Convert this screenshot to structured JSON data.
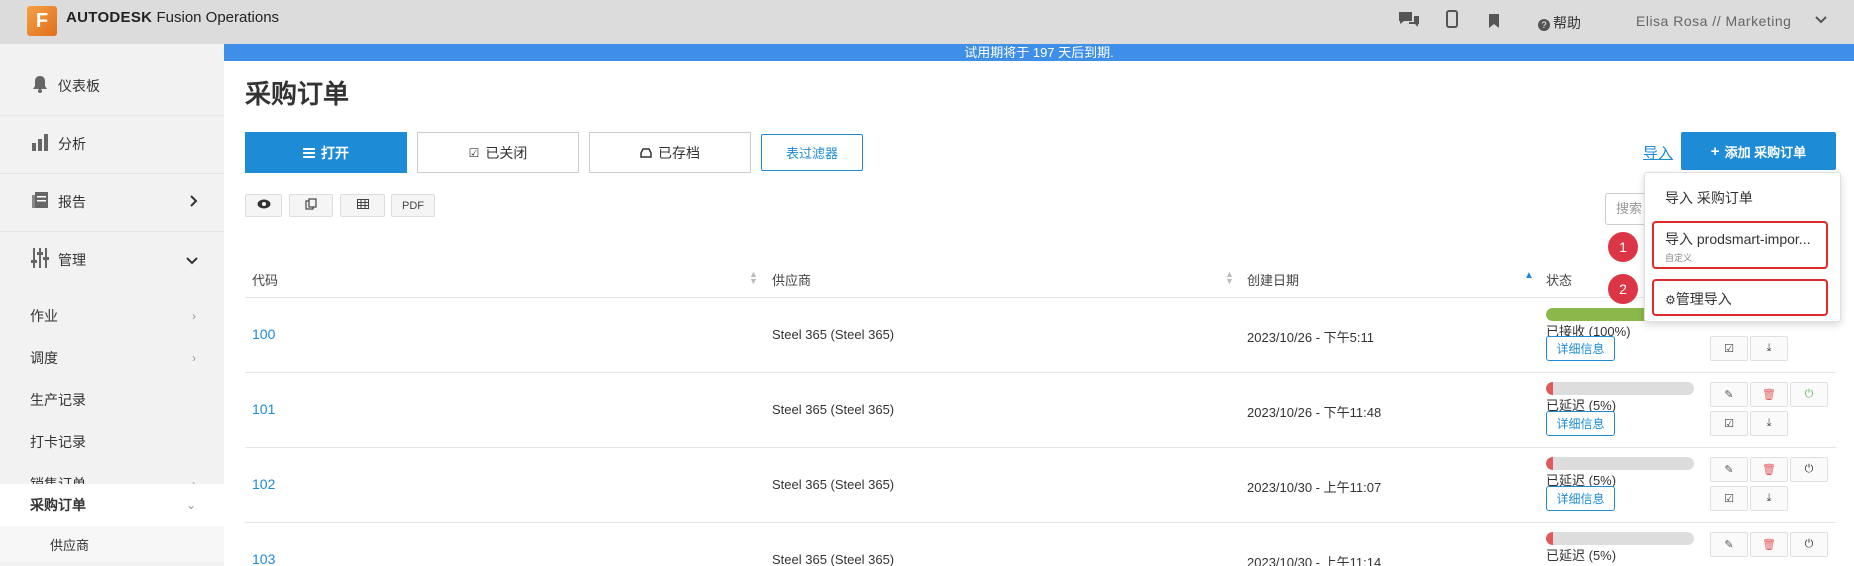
{
  "app": {
    "logo_letter": "F",
    "brand_bold": "AUTODESK",
    "brand_rest": "Fusion Operations",
    "help_label": "帮助",
    "user_label": "Elisa Rosa // Marketing",
    "trial_text": "试用期将于 197 天后到期."
  },
  "sidebar": {
    "main": [
      {
        "label": "仪表板",
        "icon": "bell-icon"
      },
      {
        "label": "分析",
        "icon": "bar-chart-icon"
      },
      {
        "label": "报告",
        "icon": "report-icon"
      },
      {
        "label": "管理",
        "icon": "sliders-icon"
      }
    ],
    "sub": [
      {
        "label": "作业"
      },
      {
        "label": "调度"
      },
      {
        "label": "生产记录"
      },
      {
        "label": "打卡记录"
      },
      {
        "label": "销售订单"
      },
      {
        "label": "采购订单"
      },
      {
        "label": "供应商"
      }
    ]
  },
  "page": {
    "title": "采购订单",
    "tabs": [
      "打开",
      "已关闭",
      "已存档"
    ],
    "filter_label": "表过滤器",
    "import_label": "导入",
    "add_label": "添加 采购订单",
    "tools": [
      "PDF"
    ],
    "search_placeholder": "搜索"
  },
  "table": {
    "headers": [
      "代码",
      "供应商",
      "创建日期",
      "状态"
    ],
    "rows": [
      {
        "code": "100",
        "supplier": "Steel 365 (Steel 365)",
        "date": "2023/10/26 - 下午5:11",
        "status": "已接收 (100%)",
        "progress": 100,
        "bar_color": "#8ab84a"
      },
      {
        "code": "101",
        "supplier": "Steel 365 (Steel 365)",
        "date": "2023/10/26 - 下午11:48",
        "status": "已延迟 (5%)",
        "progress": 5,
        "bar_color": "#e05a5a"
      },
      {
        "code": "102",
        "supplier": "Steel 365 (Steel 365)",
        "date": "2023/10/30 - 上午11:07",
        "status": "已延迟 (5%)",
        "progress": 5,
        "bar_color": "#e05a5a"
      },
      {
        "code": "103",
        "supplier": "Steel 365 (Steel 365)",
        "date": "2023/10/30 - 上午11:14",
        "status": "已延迟 (5%)",
        "progress": 5,
        "bar_color": "#e05a5a"
      }
    ],
    "detail_label": "详细信息"
  },
  "dropdown": {
    "item1": "导入 采购订单",
    "item2": "导入 prodsmart-impor...",
    "item2_sub": "自定义",
    "item3": "管理导入"
  },
  "badges": [
    "1",
    "2"
  ]
}
